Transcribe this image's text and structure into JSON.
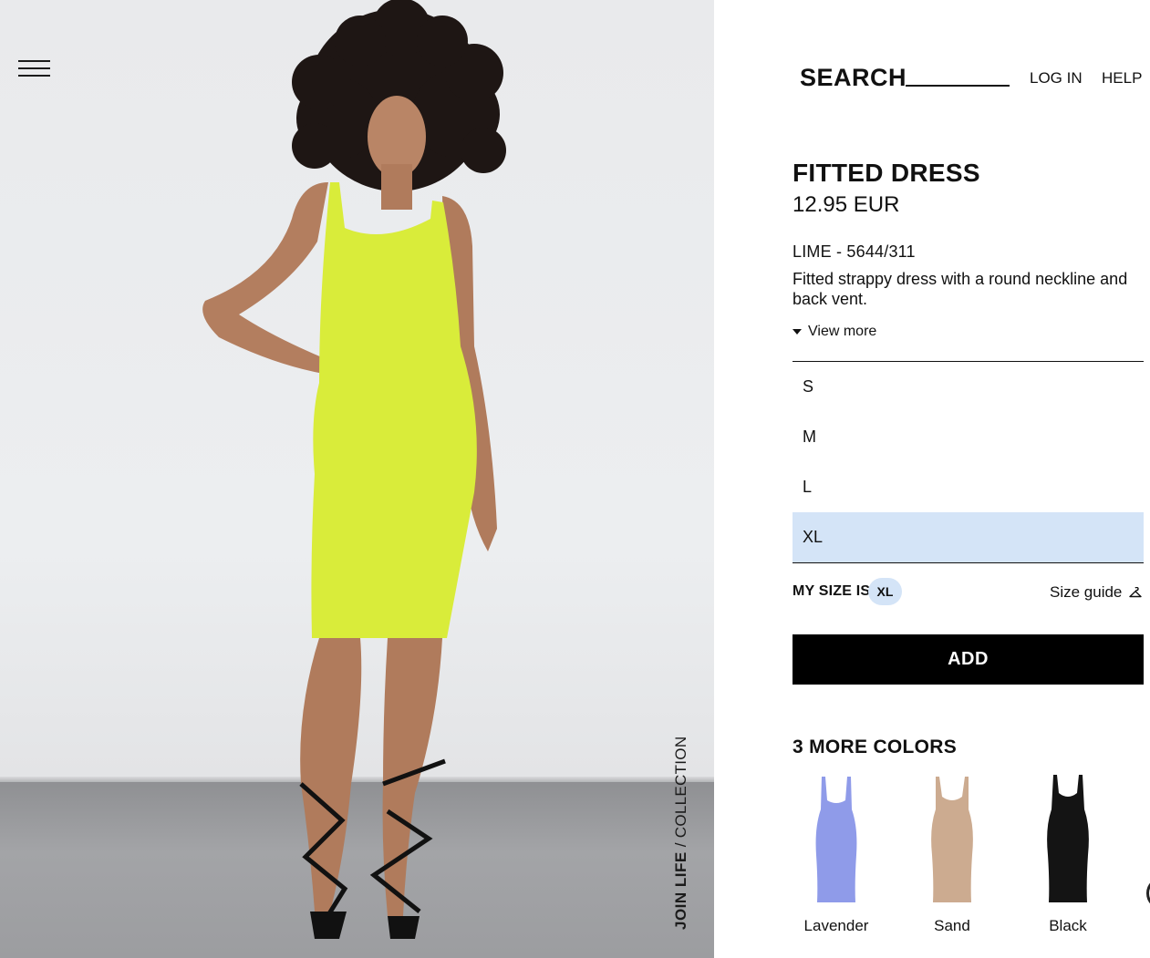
{
  "header": {
    "search_label": "SEARCH",
    "login_label": "LOG IN",
    "help_label": "HELP"
  },
  "photo": {
    "collection_brand": "JOIN LIFE",
    "collection_separator": "/",
    "collection_word": "COLLECTION"
  },
  "product": {
    "name": "FITTED DRESS",
    "price": "12.95 EUR",
    "reference": "LIME - 5644/311",
    "description": "Fitted strappy dress with a round neckline and back vent.",
    "view_more_label": "View more",
    "color": "#d9ec3a"
  },
  "sizes": [
    {
      "label": "S",
      "selected": false
    },
    {
      "label": "M",
      "selected": false
    },
    {
      "label": "L",
      "selected": false
    },
    {
      "label": "XL",
      "selected": true
    }
  ],
  "my_size": {
    "label": "MY SIZE IS",
    "value": "XL"
  },
  "size_guide_label": "Size guide",
  "add_button_label": "ADD",
  "more_colors": {
    "title": "3 MORE COLORS",
    "items": [
      {
        "name": "Lavender",
        "color": "#8f9be9"
      },
      {
        "name": "Sand",
        "color": "#ccab90"
      },
      {
        "name": "Black",
        "color": "#141414"
      }
    ]
  },
  "colors": {
    "accent": "#000000",
    "selected_size_bg": "#d4e4f7"
  }
}
